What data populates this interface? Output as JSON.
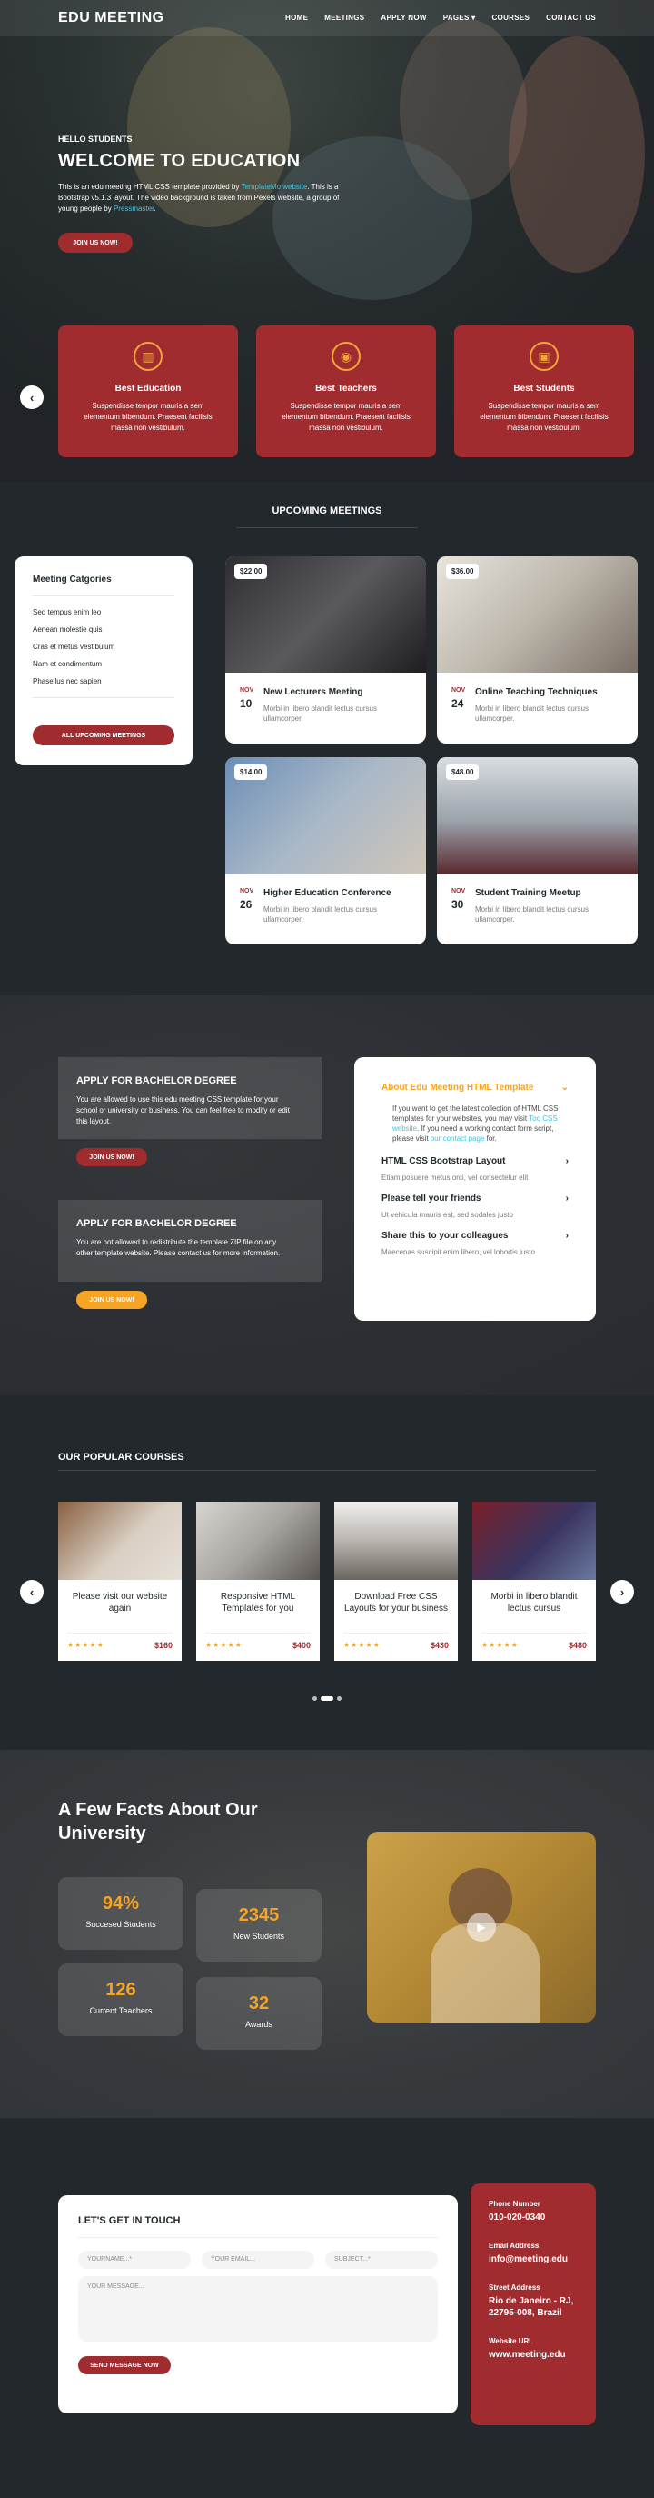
{
  "header": {
    "logo": "EDU MEETING",
    "nav": [
      "HOME",
      "MEETINGS",
      "APPLY NOW",
      "PAGES ▾",
      "COURSES",
      "CONTACT US"
    ]
  },
  "hero": {
    "subtitle": "HELLO STUDENTS",
    "title": "WELCOME TO EDUCATION",
    "desc_pre": "This is an edu meeting HTML CSS template provided by ",
    "desc_link": "TemplateMo website",
    "desc_mid": ". This is a Bootstrap v5.1.3 layout. The video background is taken from Pexels website, a group of young people by ",
    "desc_link2": "Pressmaster",
    "desc_end": ".",
    "button": "JOIN US NOW!"
  },
  "services": [
    {
      "title": "Best Education",
      "desc": "Suspendisse tempor mauris a sem elementum bibendum. Praesent facilisis massa non vestibulum.",
      "icon": "book-icon"
    },
    {
      "title": "Best Teachers",
      "desc": "Suspendisse tempor mauris a sem elementum bibendum. Praesent facilisis massa non vestibulum.",
      "icon": "teacher-icon"
    },
    {
      "title": "Best Students",
      "desc": "Suspendisse tempor mauris a sem elementum bibendum. Praesent facilisis massa non vestibulum.",
      "icon": "students-icon"
    }
  ],
  "meetings": {
    "title": "UPCOMING MEETINGS",
    "categories_title": "Meeting Catgories",
    "categories": [
      "Sed tempus enim leo",
      "Aenean molestie quis",
      "Cras et metus vestibulum",
      "Nam et condimentum",
      "Phasellus nec sapien"
    ],
    "all_button": "ALL UPCOMING MEETINGS",
    "cards": [
      {
        "price": "$22.00",
        "month": "NOV",
        "day": "10",
        "title": "New Lecturers Meeting",
        "desc": "Morbi in libero blandit lectus cursus ullamcorper."
      },
      {
        "price": "$36.00",
        "month": "NOV",
        "day": "24",
        "title": "Online Teaching Techniques",
        "desc": "Morbi in libero blandit lectus cursus ullamcorper."
      },
      {
        "price": "$14.00",
        "month": "NOV",
        "day": "26",
        "title": "Higher Education Conference",
        "desc": "Morbi in libero blandit lectus cursus ullamcorper."
      },
      {
        "price": "$48.00",
        "month": "NOV",
        "day": "30",
        "title": "Student Training Meetup",
        "desc": "Morbi in libero blandit lectus cursus ullamcorper."
      }
    ]
  },
  "apply": {
    "box1_title": "APPLY FOR BACHELOR DEGREE",
    "box1_desc": "You are allowed to use this edu meeting CSS template for your school or university or business. You can feel free to modify or edit this layout.",
    "box1_button": "JOIN US NOW!",
    "box2_title": "APPLY FOR BACHELOR DEGREE",
    "box2_desc": "You are not allowed to redistribute the template ZIP file on any other template website. Please contact us for more information.",
    "box2_button": "JOIN US NOW!",
    "accordion": {
      "h1": "About Edu Meeting HTML Template",
      "p1_pre": "If you want to get the latest collection of HTML CSS templates for your websites, you may visit ",
      "p1_link": "Too CSS website",
      "p1_mid": ". If you need a working contact form script, please visit ",
      "p1_link2": "our contact page",
      "p1_end": " for.",
      "h2": "HTML CSS Bootstrap Layout",
      "c2": "Etiam posuere metus orci, vel consectetur elit",
      "h3": "Please tell your friends",
      "c3": "Ut vehicula mauris est, sed sodales justo",
      "h4": "Share this to your colleagues",
      "c4": "Maecenas suscipit enim libero, vel lobortis justo"
    }
  },
  "courses": {
    "title": "OUR POPULAR COURSES",
    "items": [
      {
        "title": "Please visit our website again",
        "stars": "★★★★★",
        "price": "$160"
      },
      {
        "title": "Responsive HTML Templates for you",
        "stars": "★★★★★",
        "price": "$400"
      },
      {
        "title": "Download Free CSS Layouts for your business",
        "stars": "★★★★★",
        "price": "$430"
      },
      {
        "title": "Morbi in libero blandit lectus cursus",
        "stars": "★★★★★",
        "price": "$480"
      }
    ]
  },
  "facts": {
    "title": "A Few Facts About Our University",
    "items": [
      {
        "num": "94%",
        "label": "Succesed Students"
      },
      {
        "num": "2345",
        "label": "New Students"
      },
      {
        "num": "126",
        "label": "Current Teachers"
      },
      {
        "num": "32",
        "label": "Awards"
      }
    ]
  },
  "contact": {
    "title": "LET'S GET IN TOUCH",
    "name_ph": "YOURNAME...*",
    "email_ph": "YOUR EMAIL...",
    "subject_ph": "SUBJECT...*",
    "message_ph": "YOUR MESSAGE...",
    "button": "SEND MESSAGE NOW",
    "phone_label": "Phone Number",
    "phone": "010-020-0340",
    "email_label": "Email Address",
    "email": "info@meeting.edu",
    "address_label": "Street Address",
    "address": "Rio de Janeiro - RJ, 22795-008, Brazil",
    "website_label": "Website URL",
    "website": "www.meeting.edu"
  },
  "colors": {
    "accent": "#a12c2f",
    "orange": "#f5a425",
    "dark": "#1f2327",
    "link": "#39c8e6"
  }
}
